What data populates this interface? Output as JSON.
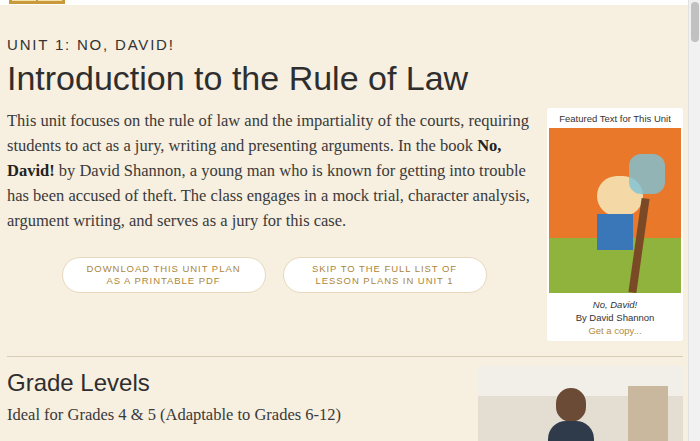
{
  "unit_label": "UNIT 1: NO, DAVID!",
  "title": "Introduction to the Rule of Law",
  "intro": [
    {
      "text": "This unit focuses on the rule of law and the impartiality of the courts, requiring students to act as a jury, writing and presenting arguments. In the book ",
      "kind": "plain"
    },
    {
      "text": "No, David!",
      "kind": "bold"
    },
    {
      "text": " by David Shannon, a young man who is known for getting into trouble has been accused of theft. The class engages in a mock trial, character analysis, argument writing, and serves as a jury for this case.",
      "kind": "plain"
    }
  ],
  "buttons": [
    {
      "lines": [
        "DOWNLOAD THIS UNIT PLAN",
        "AS A PRINTABLE PDF"
      ]
    },
    {
      "lines": [
        "SKIP TO THE FULL LIST OF",
        "LESSON PLANS IN UNIT 1"
      ]
    }
  ],
  "featured": {
    "label": "Featured Text for This Unit",
    "book_title": "No, David!",
    "author": "By David Shannon",
    "link": "Get a copy..."
  },
  "grade_levels": {
    "heading": "Grade Levels",
    "text": "Ideal for Grades 4 & 5 (Adaptable to Grades 6-12)"
  }
}
